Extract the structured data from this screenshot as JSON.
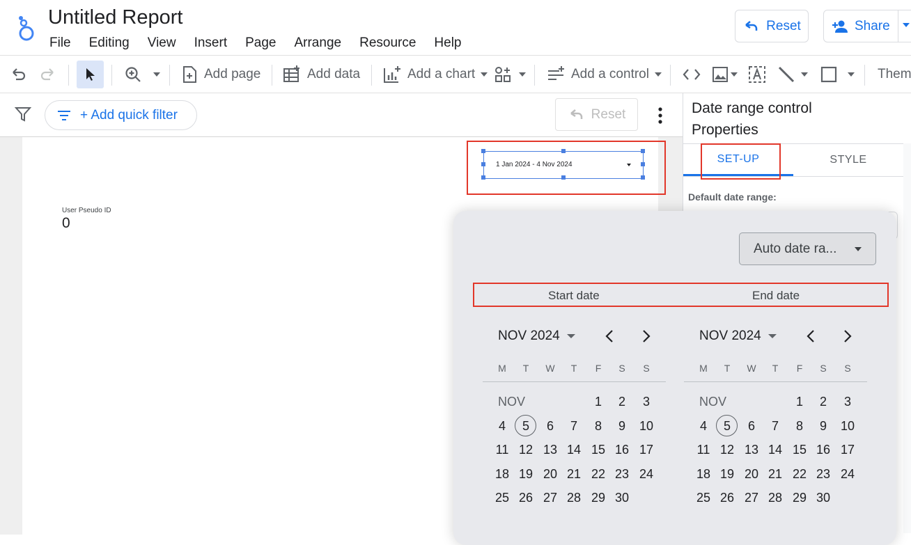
{
  "header": {
    "title": "Untitled Report",
    "menu": [
      "File",
      "Editing",
      "View",
      "Insert",
      "Page",
      "Arrange",
      "Resource",
      "Help"
    ],
    "reset_label": "Reset",
    "share_label": "Share"
  },
  "toolbar": {
    "add_page": "Add page",
    "add_data": "Add data",
    "add_chart": "Add a chart",
    "add_control": "Add a control",
    "theme": "Them"
  },
  "filterbar": {
    "quick_filter": "+ Add quick filter",
    "reset": "Reset"
  },
  "canvas": {
    "date_control_value": "1 Jan 2024 - 4 Nov 2024",
    "scorecard_label": "User Pseudo ID",
    "scorecard_value": "0"
  },
  "properties": {
    "title": "Date range control",
    "subtitle": "Properties",
    "tabs": [
      "SET-UP",
      "STYLE"
    ],
    "default_date_range_label": "Default date range:"
  },
  "calendar_popup": {
    "auto_date_range": "Auto date ra...",
    "start_date_label": "Start date",
    "end_date_label": "End date",
    "weekdays": [
      "M",
      "T",
      "W",
      "T",
      "F",
      "S",
      "S"
    ],
    "start": {
      "month_label": "NOV 2024",
      "month_short": "NOV",
      "selected_day": "5",
      "rows": [
        [
          "",
          "",
          "",
          "",
          "1",
          "2",
          "3"
        ],
        [
          "4",
          "5",
          "6",
          "7",
          "8",
          "9",
          "10"
        ],
        [
          "11",
          "12",
          "13",
          "14",
          "15",
          "16",
          "17"
        ],
        [
          "18",
          "19",
          "20",
          "21",
          "22",
          "23",
          "24"
        ],
        [
          "25",
          "26",
          "27",
          "28",
          "29",
          "30",
          ""
        ]
      ]
    },
    "end": {
      "month_label": "NOV 2024",
      "month_short": "NOV",
      "selected_day": "5",
      "rows": [
        [
          "",
          "",
          "",
          "",
          "1",
          "2",
          "3"
        ],
        [
          "4",
          "5",
          "6",
          "7",
          "8",
          "9",
          "10"
        ],
        [
          "11",
          "12",
          "13",
          "14",
          "15",
          "16",
          "17"
        ],
        [
          "18",
          "19",
          "20",
          "21",
          "22",
          "23",
          "24"
        ],
        [
          "25",
          "26",
          "27",
          "28",
          "29",
          "30",
          ""
        ]
      ]
    }
  },
  "colors": {
    "accent": "#1a73e8",
    "highlight_box": "#e2372a",
    "popup_bg": "#e8e9ed"
  }
}
